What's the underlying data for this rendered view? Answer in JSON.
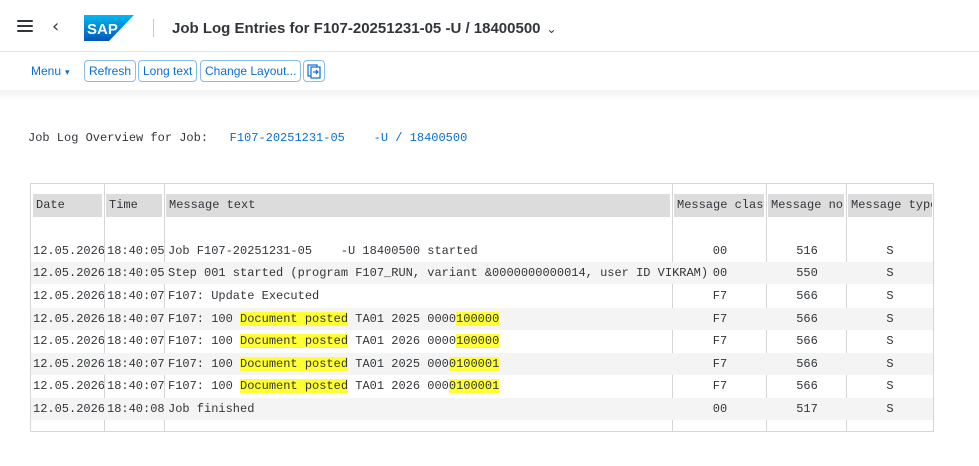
{
  "header": {
    "title": "Job Log Entries for F107-20251231-05 -U / 18400500",
    "logo_text": "SAP"
  },
  "toolbar": {
    "menu_label": "Menu",
    "refresh_label": "Refresh",
    "long_text_label": "Long text",
    "change_layout_label": "Change Layout..."
  },
  "overview": {
    "label": "Job Log Overview for Job:",
    "job_name": "F107-20251231-05",
    "job_count": "-U / 18400500"
  },
  "table": {
    "columns": [
      "Date",
      "Time",
      "Message text",
      "Message class",
      "Message no.",
      "Message type"
    ],
    "rows": [
      {
        "date": "12.05.2026",
        "time": "18:40:05",
        "text": "Job F107-20251231-05    -U 18400500 started",
        "text_highlight": "",
        "text_suffix": "",
        "msg_class": "00",
        "msg_no": "516",
        "msg_type": "S"
      },
      {
        "date": "12.05.2026",
        "time": "18:40:05",
        "text": "Step 001 started (program F107_RUN, variant &0000000000014, user ID VIKRAM)",
        "text_highlight": "",
        "text_suffix": "",
        "msg_class": "00",
        "msg_no": "550",
        "msg_type": "S"
      },
      {
        "date": "12.05.2026",
        "time": "18:40:07",
        "text": "F107: Update Executed",
        "text_highlight": "",
        "text_suffix": "",
        "msg_class": "F7",
        "msg_no": "566",
        "msg_type": "S"
      },
      {
        "date": "12.05.2026",
        "time": "18:40:07",
        "text": "F107: 100 ",
        "text_highlight": "Document posted",
        "text_suffix": " TA01 2025 0000",
        "text_highlight2": "100000",
        "msg_class": "F7",
        "msg_no": "566",
        "msg_type": "S"
      },
      {
        "date": "12.05.2026",
        "time": "18:40:07",
        "text": "F107: 100 ",
        "text_highlight": "Document posted",
        "text_suffix": " TA01 2026 0000",
        "text_highlight2": "100000",
        "msg_class": "F7",
        "msg_no": "566",
        "msg_type": "S"
      },
      {
        "date": "12.05.2026",
        "time": "18:40:07",
        "text": "F107: 100 ",
        "text_highlight": "Document posted",
        "text_suffix": " TA01 2025 000",
        "text_highlight2": "0100001",
        "msg_class": "F7",
        "msg_no": "566",
        "msg_type": "S"
      },
      {
        "date": "12.05.2026",
        "time": "18:40:07",
        "text": "F107: 100 ",
        "text_highlight": "Document posted",
        "text_suffix": " TA01 2026 000",
        "text_highlight2": "0100001",
        "msg_class": "F7",
        "msg_no": "566",
        "msg_type": "S"
      },
      {
        "date": "12.05.2026",
        "time": "18:40:08",
        "text": "Job finished",
        "text_highlight": "",
        "text_suffix": "",
        "msg_class": "00",
        "msg_no": "517",
        "msg_type": "S"
      }
    ]
  },
  "colors": {
    "accent": "#0a6ed1",
    "highlight": "#ffff33",
    "header_fill": "#dcdcdc"
  }
}
